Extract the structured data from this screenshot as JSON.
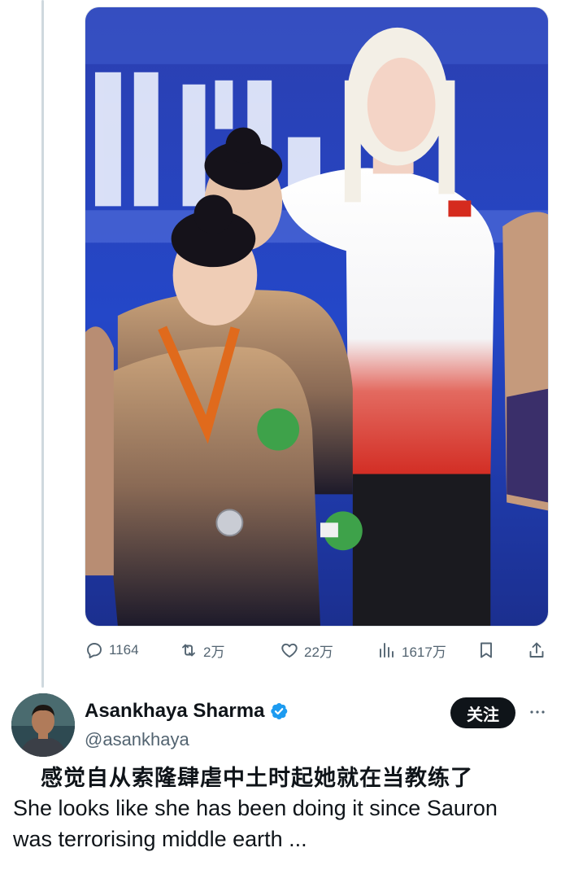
{
  "actions": {
    "replies": "1164",
    "retweets": "2万",
    "likes": "22万",
    "views": "1617万"
  },
  "author": {
    "name": "Asankhaya Sharma",
    "handle": "@asankhaya",
    "verified_color": "#1d9bf0"
  },
  "follow_label": "关注",
  "tweet": {
    "translation_cn": "感觉自从索隆肆虐中土时起她就在当教练了",
    "text": "She looks like she has been doing it since Sauron was terrorising middle earth ..."
  },
  "icons": {
    "reply": "reply-icon",
    "retweet": "retweet-icon",
    "like": "heart-icon",
    "views": "views-chart-icon",
    "bookmark": "bookmark-icon",
    "share": "share-icon",
    "more": "more-dots-icon"
  },
  "colors": {
    "text_primary": "#0f1419",
    "text_secondary": "#536471",
    "thread_line": "#cfd9de"
  }
}
